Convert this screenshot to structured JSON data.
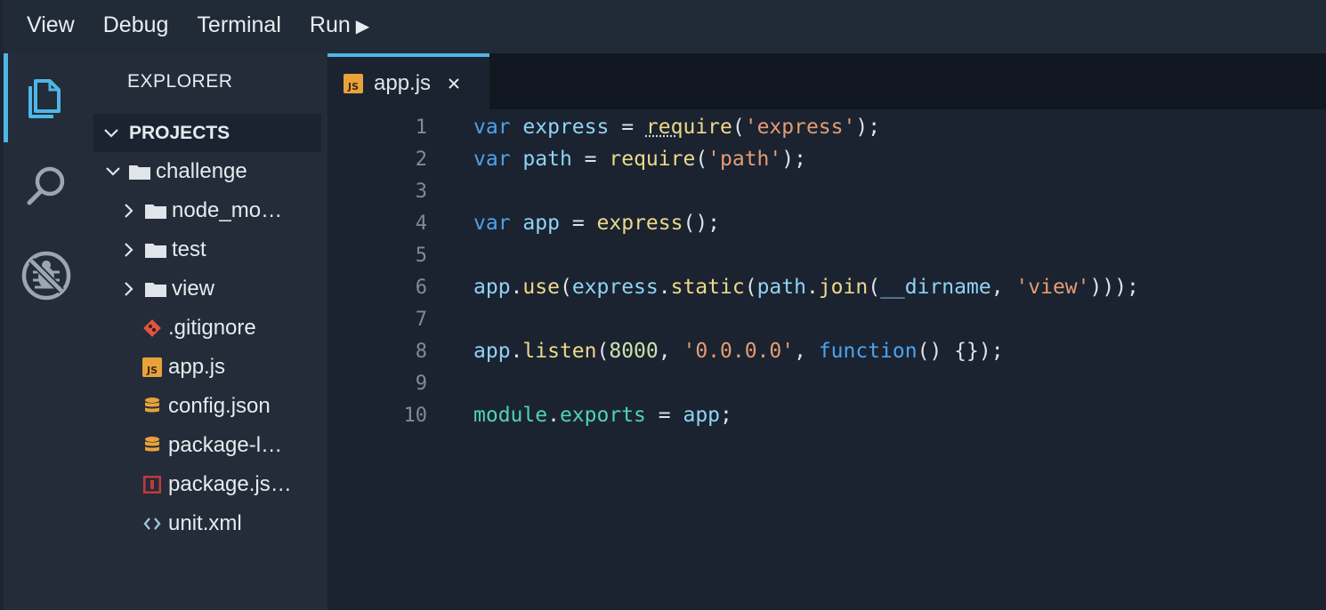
{
  "menubar": {
    "items": [
      {
        "label": "View"
      },
      {
        "label": "Debug"
      },
      {
        "label": "Terminal"
      },
      {
        "label": "Run"
      }
    ],
    "run_icon": "play-triangle-icon"
  },
  "activitybar": {
    "items": [
      {
        "name": "explorer",
        "icon": "files-icon",
        "active": true
      },
      {
        "name": "search",
        "icon": "search-icon",
        "active": false
      },
      {
        "name": "debug",
        "icon": "no-bug-icon",
        "active": false
      }
    ]
  },
  "sidebar": {
    "title": "EXPLORER",
    "section": "PROJECTS",
    "tree": [
      {
        "label": "challenge",
        "type": "folder",
        "expanded": true,
        "depth": 0
      },
      {
        "label": "node_mo…",
        "type": "folder",
        "expanded": false,
        "depth": 1
      },
      {
        "label": "test",
        "type": "folder",
        "expanded": false,
        "depth": 1
      },
      {
        "label": "view",
        "type": "folder",
        "expanded": false,
        "depth": 1
      },
      {
        "label": ".gitignore",
        "type": "file",
        "icon": "git-icon",
        "depth": 1
      },
      {
        "label": "app.js",
        "type": "file",
        "icon": "js-icon",
        "depth": 1
      },
      {
        "label": "config.json",
        "type": "file",
        "icon": "database-icon",
        "depth": 1
      },
      {
        "label": "package-l…",
        "type": "file",
        "icon": "database-icon",
        "depth": 1
      },
      {
        "label": "package.js…",
        "type": "file",
        "icon": "npm-icon",
        "depth": 1
      },
      {
        "label": "unit.xml",
        "type": "file",
        "icon": "code-brackets-icon",
        "depth": 1
      }
    ]
  },
  "editor": {
    "tab": {
      "label": "app.js",
      "icon": "js-icon",
      "badge": "JS"
    },
    "line_numbers": [
      "1",
      "2",
      "3",
      "4",
      "5",
      "6",
      "7",
      "8",
      "9",
      "10"
    ]
  },
  "colors": {
    "accent": "#4fb6e8",
    "keyword": "#4ba3f0",
    "string": "#e59b74",
    "function": "#ecd98b",
    "module": "#4fd3b4"
  }
}
